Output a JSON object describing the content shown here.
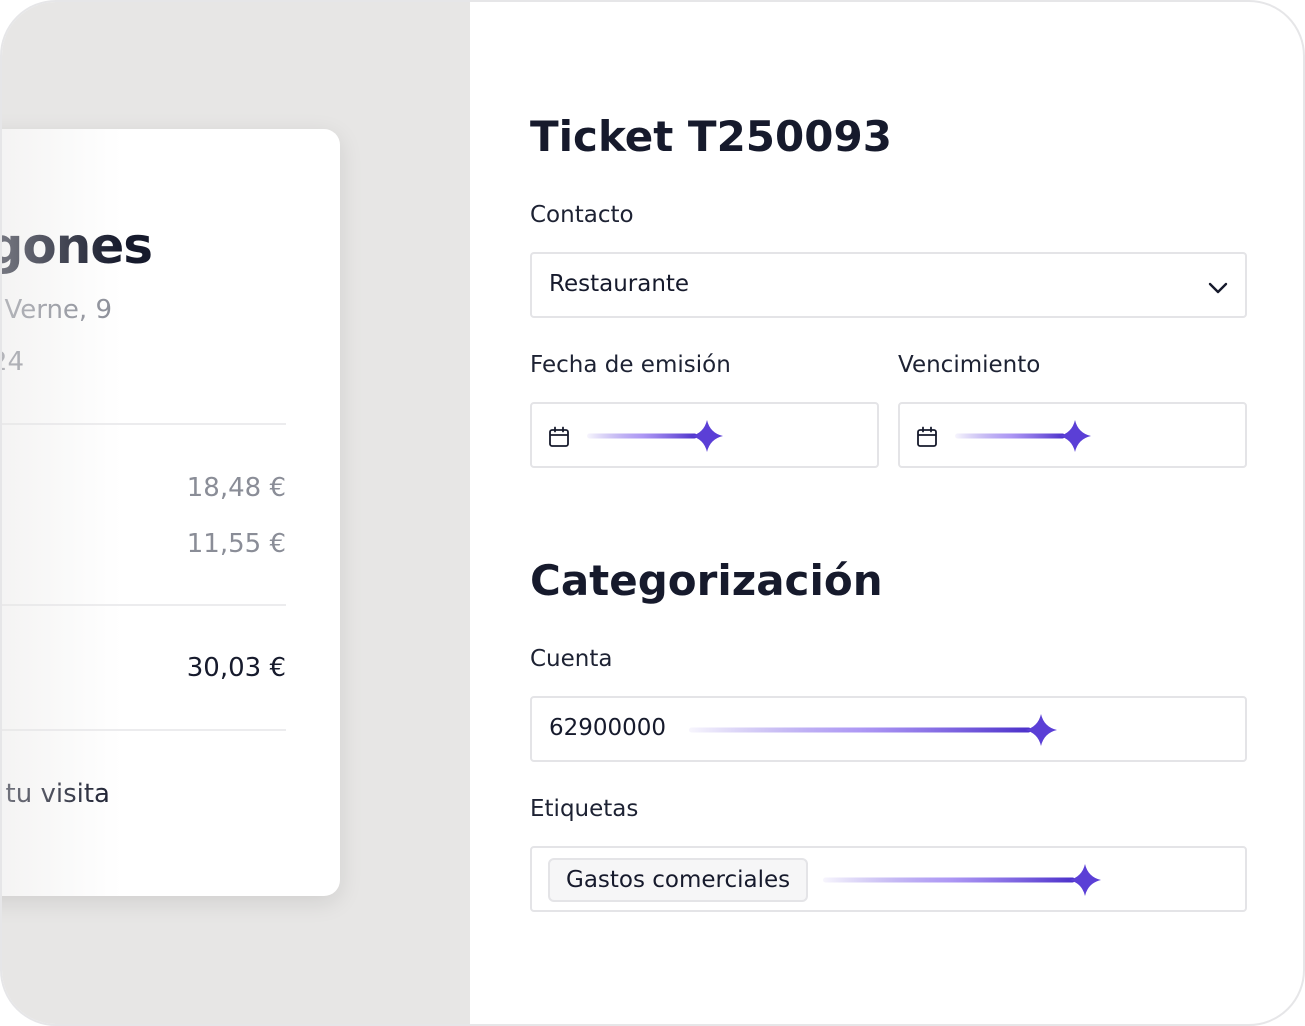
{
  "receipt": {
    "name": "gones",
    "address": "Verne, 9",
    "date": "24",
    "amounts": [
      "18,48 €",
      "11,55 €"
    ],
    "total": "30,03 €",
    "thanks": "tu visita"
  },
  "ticket": {
    "title": "Ticket T250093",
    "contact_label": "Contacto",
    "contact_value": "Restaurante",
    "issue_date_label": "Fecha de emisión",
    "due_date_label": "Vencimiento"
  },
  "categorization": {
    "title": "Categorización",
    "account_label": "Cuenta",
    "account_value": "62900000",
    "tags_label": "Etiquetas",
    "tags": [
      "Gastos comerciales"
    ]
  },
  "icons": {
    "dropdown": "chevron-down-icon",
    "calendar": "calendar-icon",
    "ai_fill": "sparkle-icon"
  },
  "colors": {
    "accent": "#5b3fd6",
    "left_panel_bg": "#e7e6e5",
    "text_dark": "#161a2c",
    "text_muted": "#8a8d97",
    "border": "#e4e4e7"
  }
}
